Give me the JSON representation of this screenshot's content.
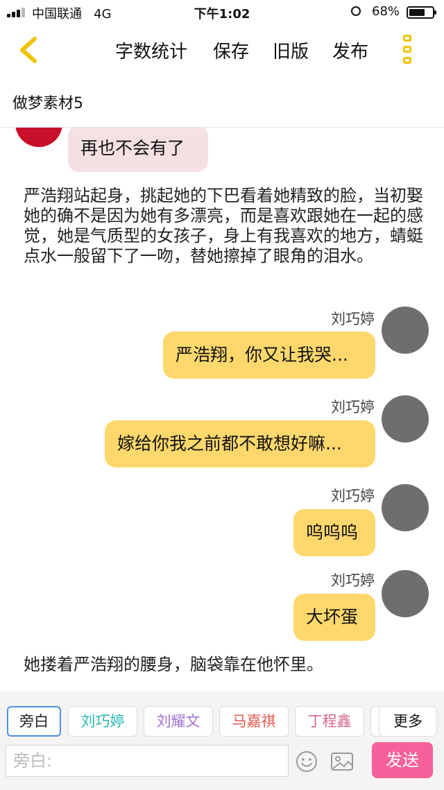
{
  "status_bar": {
    "carrier": "中国联通",
    "network": "4G",
    "time": "下午1:02",
    "battery_percent": "68%",
    "battery_level": 0.68
  },
  "nav": {
    "word_count": "字数统计",
    "save": "保存",
    "old_version": "旧版",
    "publish": "发布"
  },
  "document": {
    "title": "做梦素材5"
  },
  "messages": [
    {
      "type": "bubble-left",
      "text": "再也不会有了"
    },
    {
      "type": "narration",
      "text": "严浩翔站起身，挑起她的下巴看着她精致的脸，当初娶她的确不是因为她有多漂亮，而是喜欢跟她在一起的感觉，她是气质型的女孩子，身上有我喜欢的地方，蜻蜓点水一般留下了一吻，替她擦掉了眼角的泪水。"
    },
    {
      "type": "bubble-right",
      "speaker": "刘巧婷",
      "text": "严浩翔，你又让我哭..."
    },
    {
      "type": "bubble-right",
      "speaker": "刘巧婷",
      "text": "嫁给你我之前都不敢想好嘛..."
    },
    {
      "type": "bubble-right",
      "speaker": "刘巧婷",
      "text": "呜呜呜"
    },
    {
      "type": "bubble-right",
      "speaker": "刘巧婷",
      "text": "大坏蛋"
    },
    {
      "type": "narration",
      "text": "她搂着严浩翔的腰身，脑袋靠在他怀里。"
    }
  ],
  "roles": [
    {
      "label": "旁白",
      "color": "#222222"
    },
    {
      "label": "刘巧婷",
      "color": "#2bb8b0"
    },
    {
      "label": "刘耀文",
      "color": "#a070cf"
    },
    {
      "label": "马嘉祺",
      "color": "#e45a50"
    },
    {
      "label": "丁程鑫",
      "color": "#d4668a"
    }
  ],
  "more_label": "更多",
  "input": {
    "placeholder": "旁白:"
  },
  "send_label": "发送",
  "colors": {
    "accent_yellow": "#f2c200",
    "bubble_right": "#fed86c",
    "bubble_left": "#f5e1e3",
    "send": "#f7609a"
  }
}
